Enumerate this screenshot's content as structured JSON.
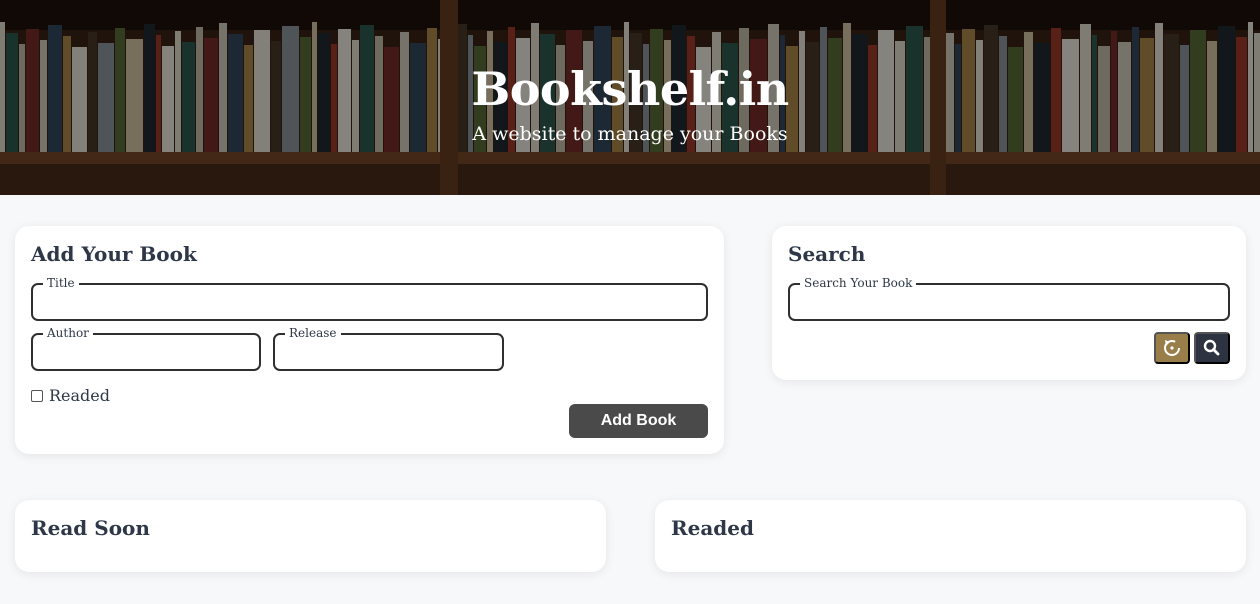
{
  "header": {
    "title": "Bookshelf.in",
    "subtitle": "A website to manage your Books"
  },
  "add_book": {
    "heading": "Add Your Book",
    "title_label": "Title",
    "title_value": "",
    "author_label": "Author",
    "author_value": "",
    "release_label": "Release",
    "release_value": "",
    "readed_label": "Readed",
    "readed_checked": false,
    "submit_label": "Add Book"
  },
  "search": {
    "heading": "Search",
    "input_label": "Search Your Book",
    "input_value": "",
    "reset_icon": "reset-icon",
    "search_icon": "magnifier-icon"
  },
  "lists": {
    "read_soon_heading": "Read Soon",
    "readed_heading": "Readed"
  },
  "colors": {
    "button_dark": "#4a4a4a",
    "button_reset": "#9a7e4a",
    "button_search": "#2d3340",
    "text": "#2d3748"
  }
}
